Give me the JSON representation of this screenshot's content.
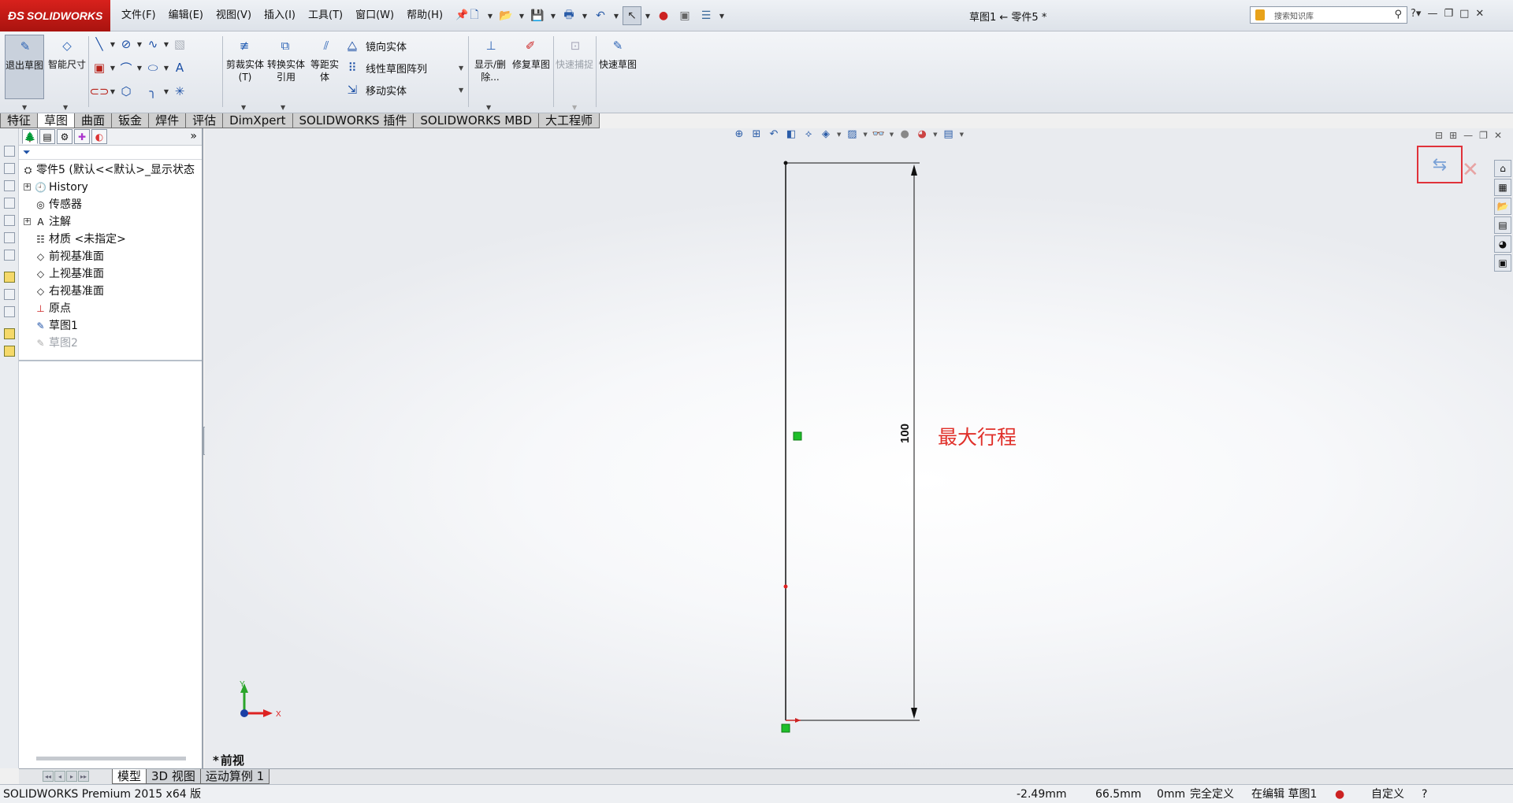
{
  "app": {
    "logo_text": "SOLIDWORKS",
    "document_title": "草图1 ← 零件5 *"
  },
  "menu": [
    "文件(F)",
    "编辑(E)",
    "视图(V)",
    "插入(I)",
    "工具(T)",
    "窗口(W)",
    "帮助(H)"
  ],
  "search": {
    "placeholder": "搜索知识库"
  },
  "commands": {
    "exit_sketch": "退出草图",
    "smart_dim": "智能尺寸",
    "trim": "剪裁实体(T)",
    "convert": "转换实体引用",
    "offset": "等距实体",
    "mirror": "镜向实体",
    "linear_pattern": "线性草图阵列",
    "move": "移动实体",
    "show_delete": "显示/删除...",
    "repair": "修复草图",
    "quick_snap": "快速捕捉",
    "rapid_sketch": "快速草图"
  },
  "tabs": [
    "特征",
    "草图",
    "曲面",
    "钣金",
    "焊件",
    "评估",
    "DimXpert",
    "SOLIDWORKS 插件",
    "SOLIDWORKS MBD",
    "大工程师"
  ],
  "active_tab": "草图",
  "tree": {
    "root": "零件5 (默认<<默认>_显示状态",
    "items": [
      {
        "label": "History",
        "expandable": true
      },
      {
        "label": "传感器",
        "expandable": false
      },
      {
        "label": "注解",
        "expandable": true
      },
      {
        "label": "材质 <未指定>",
        "expandable": false
      },
      {
        "label": "前视基准面",
        "expandable": false
      },
      {
        "label": "上视基准面",
        "expandable": false
      },
      {
        "label": "右视基准面",
        "expandable": false
      },
      {
        "label": "原点",
        "expandable": false
      },
      {
        "label": "草图1",
        "expandable": false
      },
      {
        "label": "草图2",
        "expandable": false,
        "greyed": true
      }
    ]
  },
  "viewport": {
    "dimension_value": "100",
    "annotation": "最大行程",
    "view_name": "前视",
    "triad_x": "X",
    "triad_y": "Y"
  },
  "bottom_tabs": [
    "模型",
    "3D 视图",
    "运动算例 1"
  ],
  "active_bottom_tab": "模型",
  "status": {
    "product": "SOLIDWORKS Premium 2015 x64 版",
    "x": "-2.49mm",
    "y": "66.5mm",
    "z": "0mm",
    "state": "完全定义",
    "editing": "在编辑 草图1",
    "units": "自定义"
  },
  "colors": {
    "accent_red": "#e0302a",
    "logo_red": "#c41a17",
    "sketch_green": "#1fbf2a"
  }
}
